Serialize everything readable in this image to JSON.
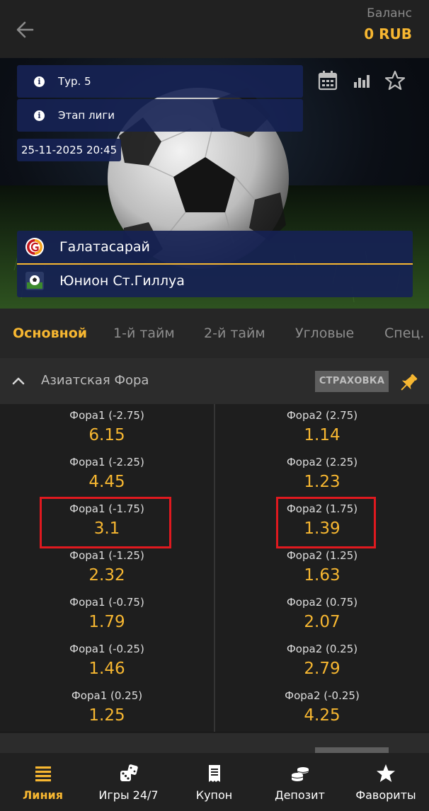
{
  "header": {
    "back_icon": "arrow-left-icon",
    "balance_label": "Баланс",
    "balance_value": "0 RUB"
  },
  "match": {
    "info": [
      {
        "icon": "info-icon",
        "text": "Тур. 5"
      },
      {
        "icon": "info-icon",
        "text": "Этап лиги"
      }
    ],
    "date": "25-11-2025 20:45",
    "actions": [
      "calendar-icon",
      "stats-icon",
      "star-outline-icon"
    ],
    "team1": {
      "name": "Галатасарай",
      "logo": "galatasaray-logo"
    },
    "team2": {
      "name": "Юнион Ст.Гиллуа",
      "logo": "union-sg-logo"
    }
  },
  "tabs": [
    {
      "label": "Основной",
      "active": true
    },
    {
      "label": "1-й тайм",
      "active": false
    },
    {
      "label": "2-й тайм",
      "active": false
    },
    {
      "label": "Угловые",
      "active": false
    },
    {
      "label": "Спец.",
      "active": false
    }
  ],
  "market": {
    "title": "Азиатская Фора",
    "insurance_label": "СТРАХОВКА",
    "pin_icon": "pin-icon",
    "rows": [
      {
        "left_label": "Фора1 (-2.75)",
        "left_odd": "6.15",
        "right_label": "Фора2 (2.75)",
        "right_odd": "1.14"
      },
      {
        "left_label": "Фора1 (-2.25)",
        "left_odd": "4.45",
        "right_label": "Фора2 (2.25)",
        "right_odd": "1.23"
      },
      {
        "left_label": "Фора1 (-1.75)",
        "left_odd": "3.1",
        "right_label": "Фора2 (1.75)",
        "right_odd": "1.39"
      },
      {
        "left_label": "Фора1 (-1.25)",
        "left_odd": "2.32",
        "right_label": "Фора2 (1.25)",
        "right_odd": "1.63"
      },
      {
        "left_label": "Фора1 (-0.75)",
        "left_odd": "1.79",
        "right_label": "Фора2 (0.75)",
        "right_odd": "2.07"
      },
      {
        "left_label": "Фора1 (-0.25)",
        "left_odd": "1.46",
        "right_label": "Фора2 (0.25)",
        "right_odd": "2.79"
      },
      {
        "left_label": "Фора1 (0.25)",
        "left_odd": "1.25",
        "right_label": "Фора2 (-0.25)",
        "right_odd": "4.25"
      }
    ]
  },
  "colors": {
    "accent": "#f7b731",
    "highlight": "#e0191f",
    "info_box": "#162254"
  },
  "bottom_nav": [
    {
      "label": "Линия",
      "icon": "menu-lines-icon",
      "active": true
    },
    {
      "label": "Игры 24/7",
      "icon": "dice-icon",
      "active": false
    },
    {
      "label": "Купон",
      "icon": "coupon-icon",
      "active": false
    },
    {
      "label": "Депозит",
      "icon": "coins-icon",
      "active": false
    },
    {
      "label": "Фавориты",
      "icon": "star-icon",
      "active": false
    }
  ]
}
